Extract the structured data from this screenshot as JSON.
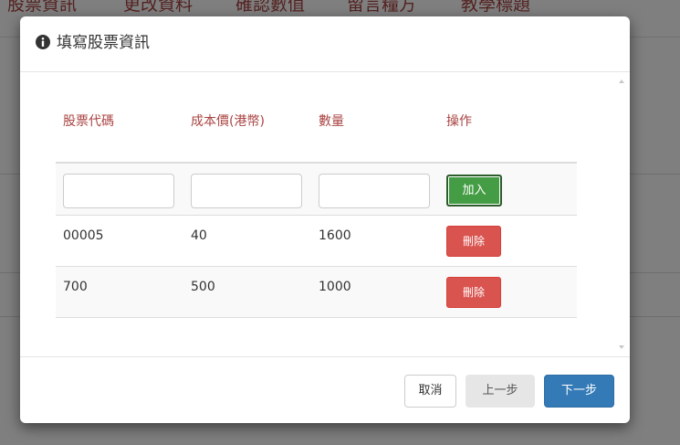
{
  "background": {
    "nav_items": [
      "股票資訊",
      "更改資料",
      "確認數值",
      "留言糧方",
      "教學標題"
    ]
  },
  "modal": {
    "icon": "info-circle-icon",
    "title": "填寫股票資訊",
    "table": {
      "headers": [
        "股票代碼",
        "成本價(港幣)",
        "數量",
        "操作"
      ],
      "input_row": {
        "code_value": "",
        "cost_value": "",
        "quantity_value": "",
        "add_label": "加入"
      },
      "rows": [
        {
          "code": "00005",
          "cost": "40",
          "quantity": "1600",
          "delete_label": "刪除"
        },
        {
          "code": "700",
          "cost": "500",
          "quantity": "1000",
          "delete_label": "刪除"
        }
      ]
    },
    "footer": {
      "cancel_label": "取消",
      "prev_label": "上一步",
      "next_label": "下一步"
    }
  },
  "colors": {
    "header_text": "#a94442",
    "add_button": "#449d44",
    "delete_button": "#d9534f",
    "primary_button": "#337ab7"
  }
}
